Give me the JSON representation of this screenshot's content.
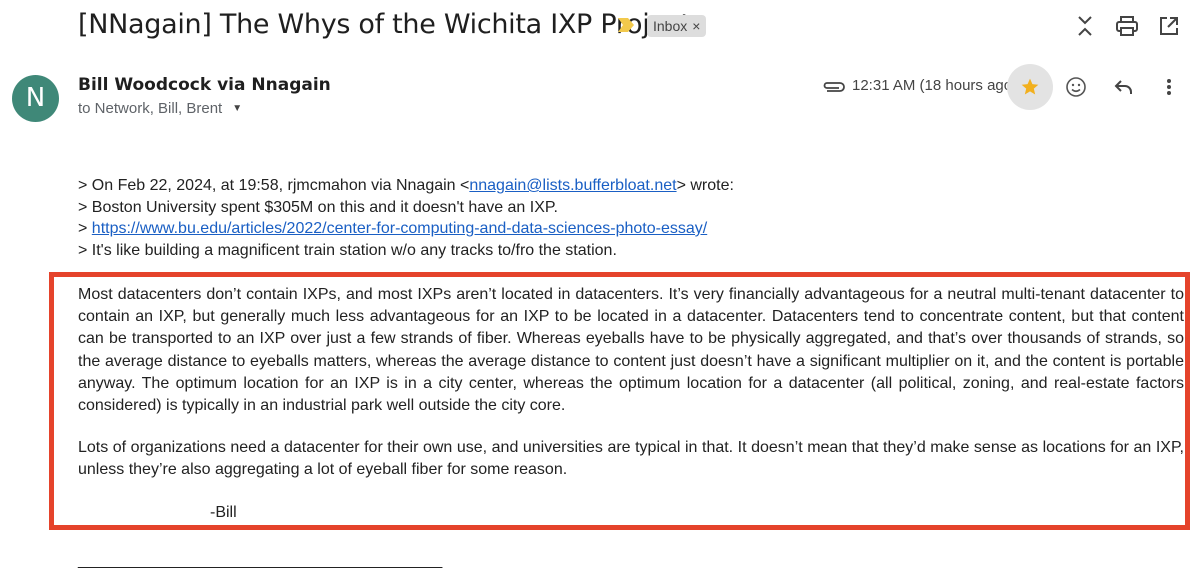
{
  "email": {
    "subject": "[NNagain] The Whys of the Wichita IXP Project",
    "label": "Inbox",
    "label_remove": "×",
    "sender": "Bill Woodcock via Nnagain",
    "avatar_letter": "N",
    "recipients": "to Network, Bill, Brent",
    "timestamp": "12:31 AM (18 hours ago)",
    "starred": true
  },
  "colors": {
    "avatar": "#3f8878",
    "highlight_border": "#e5432b",
    "link": "#1a5fc4",
    "star": "#f2b01e"
  },
  "quote": {
    "line1_prefix": "> On Feb 22, 2024, at 19:58, rjmcmahon via Nnagain <",
    "line1_link": "nnagain@lists.bufferbloat.net",
    "line1_suffix": "> wrote:",
    "line2": "> Boston University spent $305M on this and it doesn't have an IXP.",
    "line3_prefix": "> ",
    "line3_link": "https://www.bu.edu/articles/2022/center-for-computing-and-data-sciences-photo-essay/",
    "line4": "> It's like building a magnificent train station w/o any tracks to/fro the station."
  },
  "body": {
    "paragraph1": "Most datacenters don’t contain IXPs, and most IXPs aren’t located in datacenters.  It’s very financially advantageous for a neutral multi-tenant datacenter to contain an IXP, but generally much less advantageous for an IXP to be located in a datacenter.  Datacenters tend to concentrate content, but that content can be transported to an IXP over just a few strands of fiber.  Whereas eyeballs have to be physically aggregated, and that’s over thousands of strands, so the average distance to eyeballs matters, whereas the average distance to content just doesn’t have a significant multiplier on it, and the content is portable anyway.  The optimum location for an IXP is in a city center, whereas the optimum location for a datacenter (all political, zoning, and real-estate factors considered) is typically in an industrial park well outside the city core.",
    "paragraph2": "Lots of organizations need a datacenter for their own use, and universities are typical in that.  It doesn’t mean that they’d make sense as locations for an IXP, unless they’re also aggregating a lot of eyeball fiber for some reason.",
    "signature": "-Bill",
    "separator": "______________________________________________"
  },
  "icons": {
    "importance": "importance-marker-icon",
    "expand": "expand-collapse-icon",
    "print": "print-icon",
    "open_new": "open-in-new-window-icon",
    "attachment": "paperclip-icon",
    "star": "star-icon",
    "emoji": "emoji-reaction-icon",
    "reply": "reply-icon",
    "more": "more-vertical-icon",
    "caret": "caret-down-icon"
  }
}
